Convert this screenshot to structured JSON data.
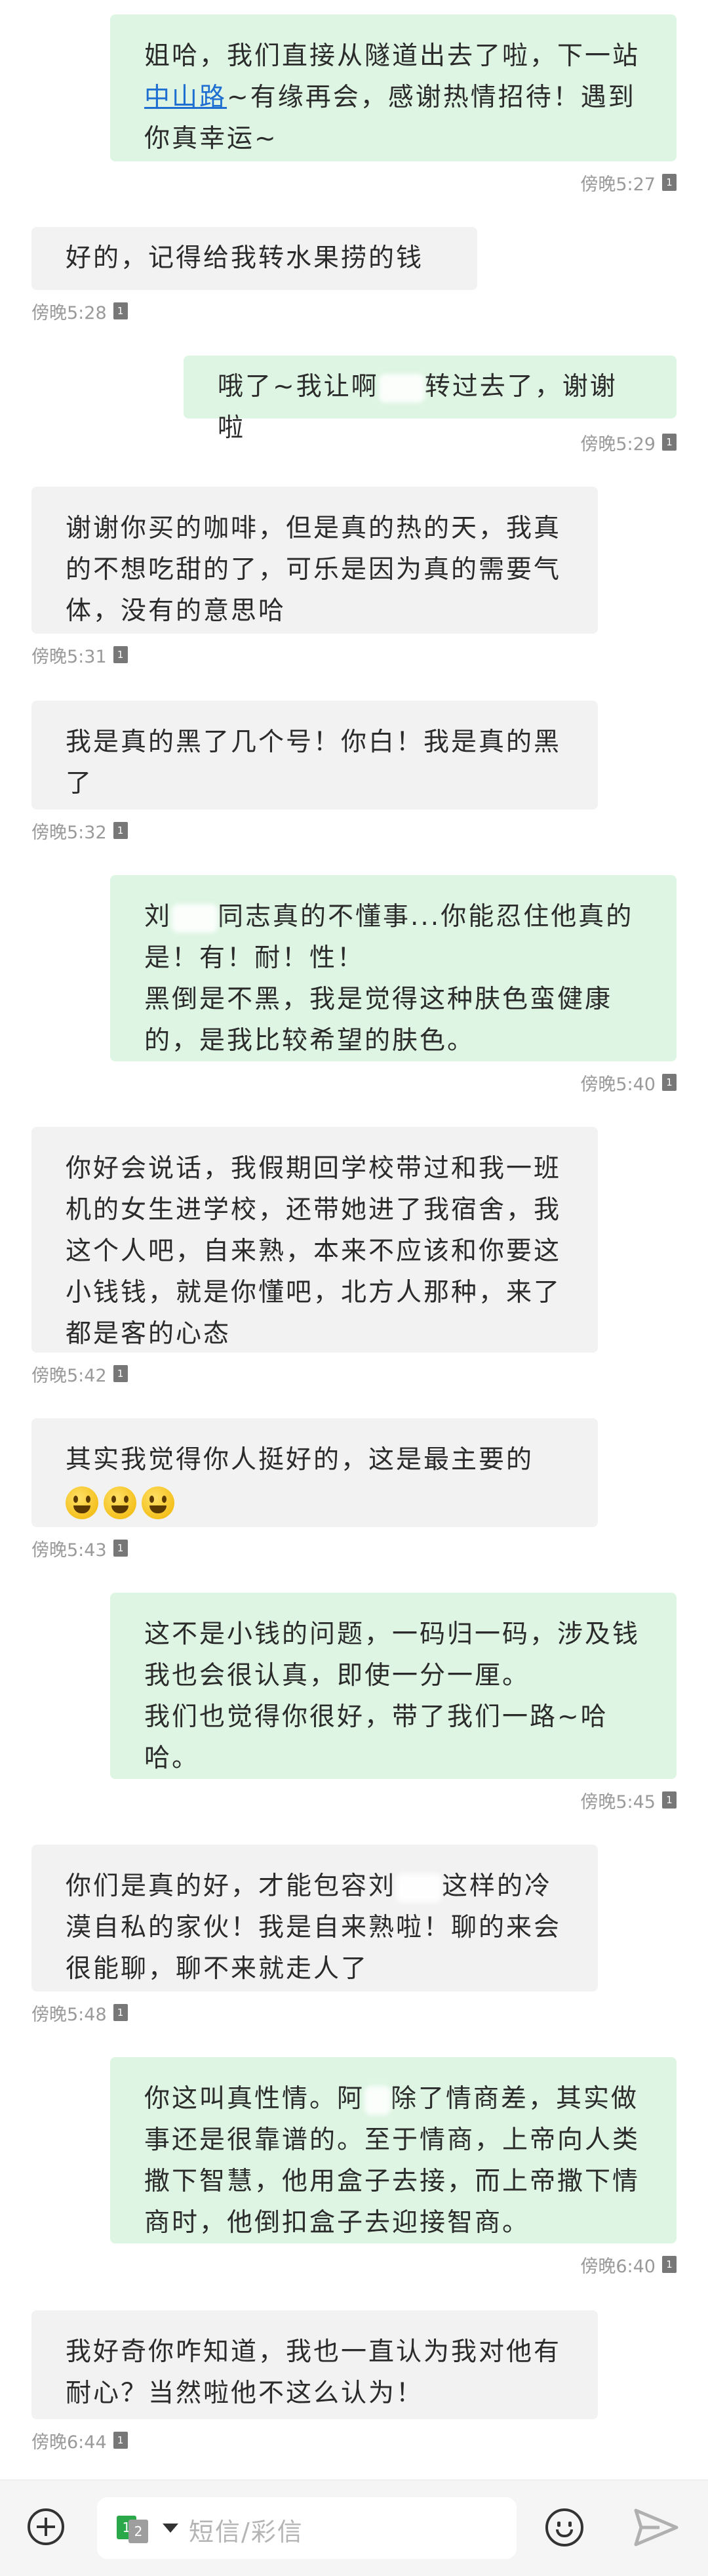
{
  "messages": [
    {
      "direction": "out",
      "text_1": "姐哈，我们直接从隧道出去了啦，下一站",
      "link": "中山路",
      "text_2": "~有缘再会，感谢热情招待！遇到你真幸运~",
      "time": "傍晚5:27"
    },
    {
      "direction": "in",
      "text": "好的，记得给我转水果捞的钱",
      "time": "傍晚5:28"
    },
    {
      "direction": "out",
      "text_1": "哦了~我让啊",
      "text_2": "转过去了，谢谢啦",
      "time": "傍晚5:29"
    },
    {
      "direction": "in",
      "text": "谢谢你买的咖啡，但是真的热的天，我真的不想吃甜的了，可乐是因为真的需要气体，没有的意思哈",
      "time": "傍晚5:31"
    },
    {
      "direction": "in",
      "text": "我是真的黑了几个号！你白！我是真的黑了",
      "time": "傍晚5:32"
    },
    {
      "direction": "out",
      "text_1": "刘",
      "text_2": "同志真的不懂事...你能忍住他真的是！有！耐！性！\n黑倒是不黑，我是觉得这种肤色蛮健康的，是我比较希望的肤色。",
      "time": "傍晚5:40"
    },
    {
      "direction": "in",
      "text": "你好会说话，我假期回学校带过和我一班机的女生进学校，还带她进了我宿舍，我这个人吧，自来熟，本来不应该和你要这小钱钱，就是你懂吧，北方人那种，来了都是客的心态",
      "time": "傍晚5:42"
    },
    {
      "direction": "in",
      "text": "其实我觉得你人挺好的，这是最主要的",
      "time": "傍晚5:43"
    },
    {
      "direction": "out",
      "text": "这不是小钱的问题，一码归一码，涉及钱我也会很认真，即使一分一厘。\n我们也觉得你很好，带了我们一路~哈哈。",
      "time": "傍晚5:45"
    },
    {
      "direction": "in",
      "text_1": "你们是真的好，才能包容刘",
      "text_2": "这样的冷漠自私的家伙！我是自来熟啦！聊的来会很能聊，聊不来就走人了",
      "time": "傍晚5:48"
    },
    {
      "direction": "out",
      "text_1": "你这叫真性情。阿",
      "text_2": "除了情商差，其实做事还是很靠谱的。至于情商，上帝向人类撒下智慧，他用盒子去接，而上帝撒下情商时，他倒扣盒子去迎接智商。",
      "time": "傍晚6:40"
    },
    {
      "direction": "in",
      "text": "我好奇你咋知道，我也一直认为我对他有耐心？当然啦他不这么认为！",
      "time": "傍晚6:44"
    }
  ],
  "sim_label": "1",
  "composer": {
    "placeholder": "短信/彩信",
    "sim_primary": "1",
    "sim_secondary": "2",
    "icons": [
      "add-icon",
      "sim-switch-icon",
      "emoji-icon",
      "send-icon"
    ]
  },
  "colors": {
    "outgoing": "#ddf5e2",
    "incoming": "#f2f2f2",
    "link": "#1e6fd1"
  }
}
